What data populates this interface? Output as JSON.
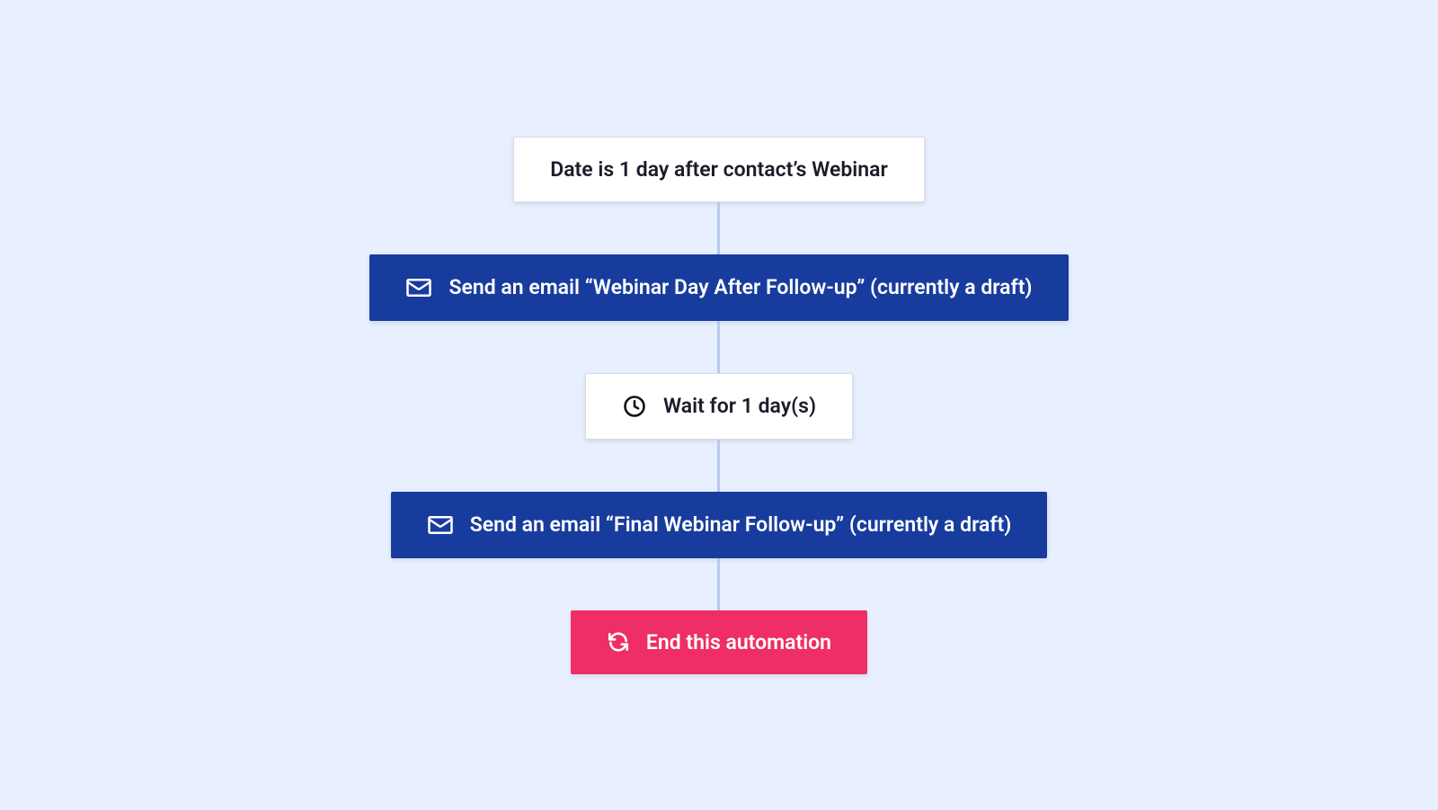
{
  "flow": {
    "trigger": {
      "label": "Date is 1 day after contact’s Webinar"
    },
    "step1": {
      "label": "Send an email “Webinar Day After Follow-up” (currently a draft)"
    },
    "step2": {
      "label": "Wait for 1 day(s)"
    },
    "step3": {
      "label": "Send an email “Final Webinar Follow-up” (currently a draft)"
    },
    "end": {
      "label": "End this automation"
    }
  },
  "colors": {
    "background": "#e8efff",
    "action": "#183c9e",
    "end": "#ee2e64",
    "connector": "#b8c8ef"
  }
}
